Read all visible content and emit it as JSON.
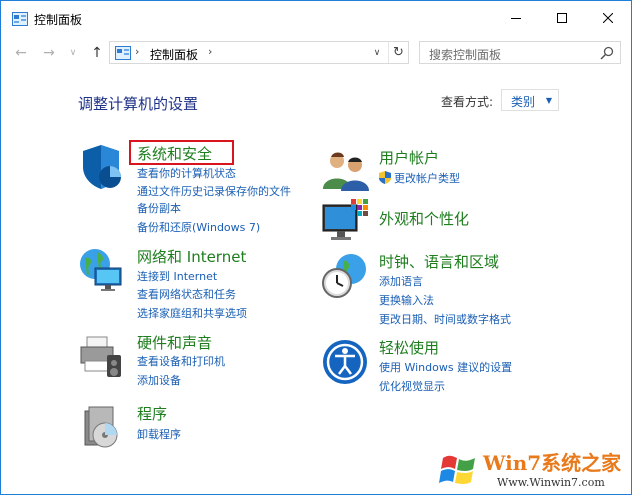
{
  "window": {
    "title": "控制面板"
  },
  "nav": {
    "address_segment": "控制面板",
    "search_placeholder": "搜索控制面板"
  },
  "content": {
    "heading": "调整计算机的设置",
    "view_by_label": "查看方式:",
    "view_by_value": "类别"
  },
  "categories": [
    {
      "title": "系统和安全",
      "icon": "security-shield-icon",
      "links": [
        "查看你的计算机状态",
        "通过文件历史记录保存你的文件",
        "备份副本",
        "备份和还原(Windows 7)"
      ]
    },
    {
      "title": "网络和 Internet",
      "icon": "network-globe-icon",
      "links": [
        "连接到 Internet",
        "查看网络状态和任务",
        "选择家庭组和共享选项"
      ]
    },
    {
      "title": "硬件和声音",
      "icon": "printer-speaker-icon",
      "links": [
        "查看设备和打印机",
        "添加设备"
      ]
    },
    {
      "title": "程序",
      "icon": "programs-disc-icon",
      "links": [
        "卸载程序"
      ]
    },
    {
      "title": "用户帐户",
      "icon": "users-icon",
      "links": [
        "更改帐户类型"
      ]
    },
    {
      "title": "外观和个性化",
      "icon": "monitor-palette-icon",
      "links": []
    },
    {
      "title": "时钟、语言和区域",
      "icon": "clock-globe-icon",
      "links": [
        "添加语言",
        "更换输入法",
        "更改日期、时间或数字格式"
      ]
    },
    {
      "title": "轻松使用",
      "icon": "ease-of-access-icon",
      "links": [
        "使用 Windows 建议的设置",
        "优化视觉显示"
      ]
    }
  ],
  "watermark": {
    "text": "Win7系统之家",
    "url": "Www.Winwin7.com"
  }
}
